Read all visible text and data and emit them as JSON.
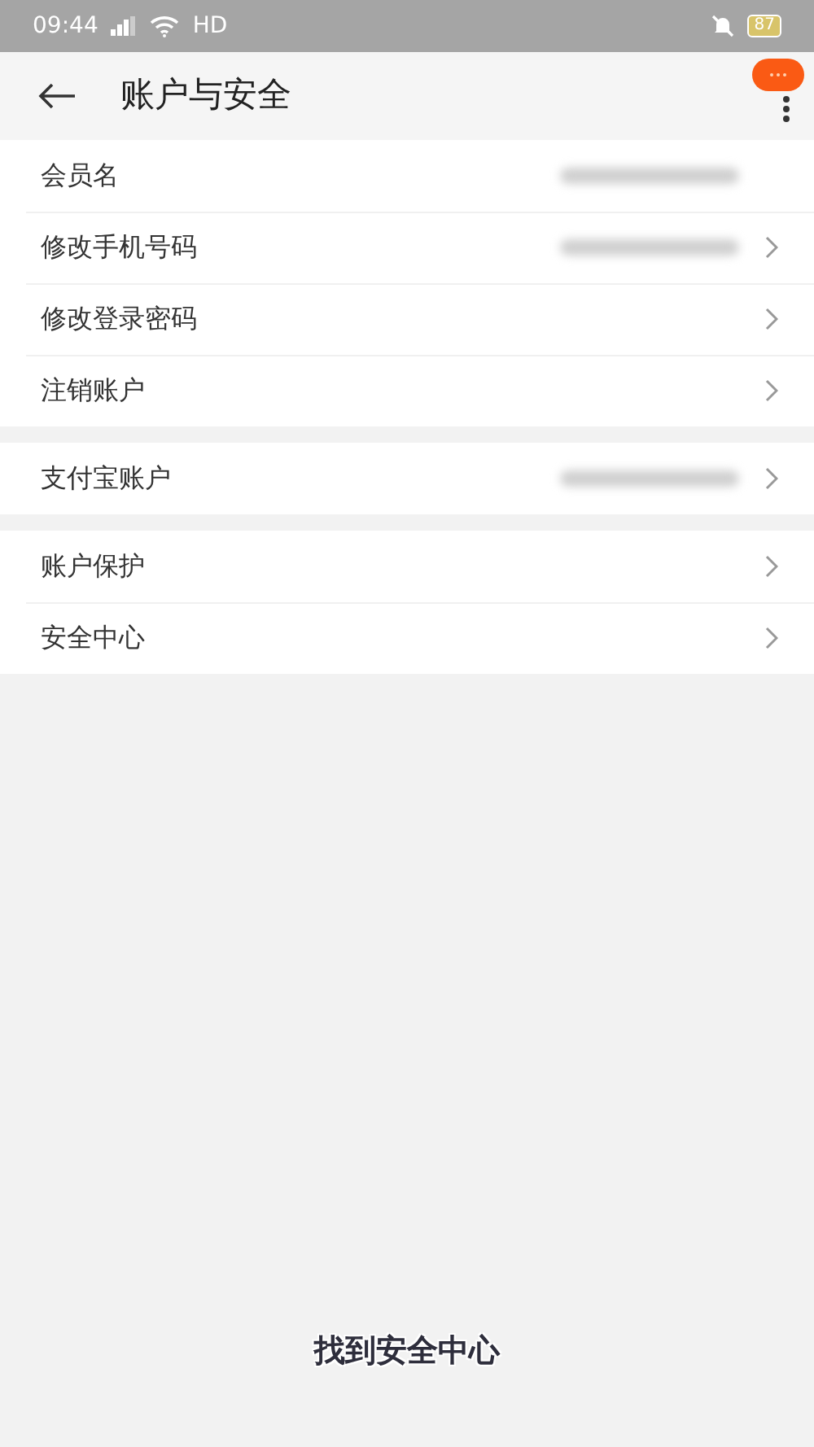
{
  "status_bar": {
    "time": "09:44",
    "network": "HD",
    "battery": "87"
  },
  "header": {
    "title": "账户与安全"
  },
  "groups": [
    {
      "items": [
        {
          "label": "会员名",
          "chevron": false,
          "value_hidden": true
        },
        {
          "label": "修改手机号码",
          "chevron": true,
          "value_hidden": true
        },
        {
          "label": "修改登录密码",
          "chevron": true,
          "value_hidden": false
        },
        {
          "label": "注销账户",
          "chevron": true,
          "value_hidden": false
        }
      ]
    },
    {
      "items": [
        {
          "label": "支付宝账户",
          "chevron": true,
          "value_hidden": true
        }
      ]
    },
    {
      "items": [
        {
          "label": "账户保护",
          "chevron": true,
          "value_hidden": false
        },
        {
          "label": "安全中心",
          "chevron": true,
          "value_hidden": false
        }
      ]
    }
  ],
  "caption": "找到安全中心"
}
